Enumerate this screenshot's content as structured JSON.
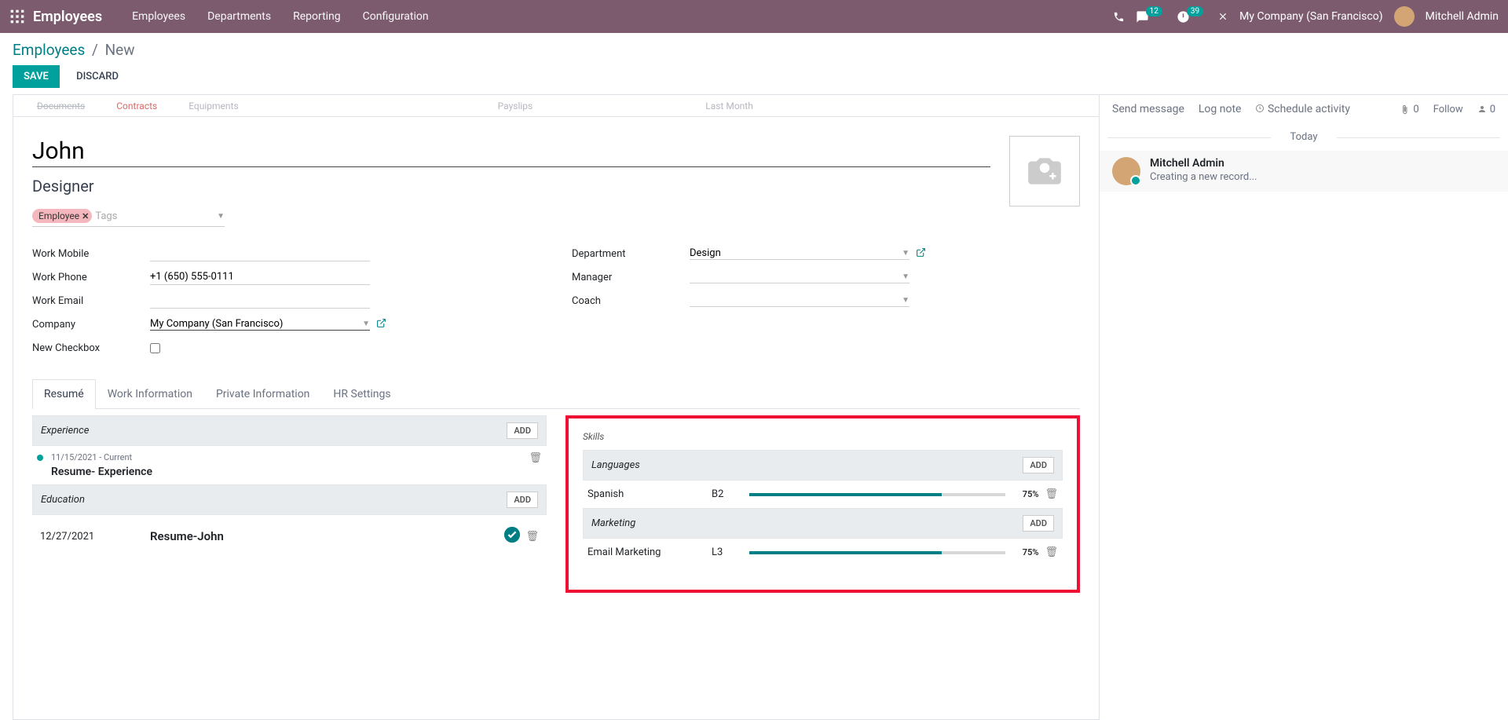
{
  "topnav": {
    "brand": "Employees",
    "menu": [
      "Employees",
      "Departments",
      "Reporting",
      "Configuration"
    ],
    "msg_badge": "12",
    "clock_badge": "39",
    "company": "My Company (San Francisco)",
    "user": "Mitchell Admin"
  },
  "breadcrumb": {
    "root": "Employees",
    "current": "New"
  },
  "buttons": {
    "save": "SAVE",
    "discard": "DISCARD"
  },
  "statbtns": {
    "documents": "Documents",
    "contracts": "Contracts",
    "equipments": "Equipments",
    "payslips": "Payslips",
    "lastmonth": "Last Month"
  },
  "form": {
    "name": "John",
    "job_title": "Designer",
    "tag": "Employee",
    "tags_placeholder": "Tags",
    "labels": {
      "work_mobile": "Work Mobile",
      "work_phone": "Work Phone",
      "work_email": "Work Email",
      "company": "Company",
      "new_checkbox": "New Checkbox",
      "department": "Department",
      "manager": "Manager",
      "coach": "Coach"
    },
    "values": {
      "work_mobile": "",
      "work_phone": "+1 (650) 555-0111",
      "work_email": "",
      "company": "My Company (San Francisco)",
      "department": "Design",
      "manager": "",
      "coach": ""
    }
  },
  "tabs": [
    "Resumé",
    "Work Information",
    "Private Information",
    "HR Settings"
  ],
  "resume": {
    "experience_header": "Experience",
    "education_header": "Education",
    "add": "ADD",
    "exp": {
      "date": "11/15/2021 - Current",
      "title": "Resume- Experience"
    },
    "edu": {
      "date": "12/27/2021",
      "title": "Resume-John"
    }
  },
  "skills": {
    "header": "Skills",
    "add": "ADD",
    "groups": [
      {
        "name": "Languages",
        "items": [
          {
            "name": "Spanish",
            "level": "B2",
            "pct": 75,
            "pct_label": "75%"
          }
        ]
      },
      {
        "name": "Marketing",
        "items": [
          {
            "name": "Email Marketing",
            "level": "L3",
            "pct": 75,
            "pct_label": "75%"
          }
        ]
      }
    ]
  },
  "chatter": {
    "send": "Send message",
    "log": "Log note",
    "schedule": "Schedule activity",
    "attach_count": "0",
    "follow": "Follow",
    "follower_count": "0",
    "today": "Today",
    "msg_author": "Mitchell Admin",
    "msg_text": "Creating a new record..."
  }
}
